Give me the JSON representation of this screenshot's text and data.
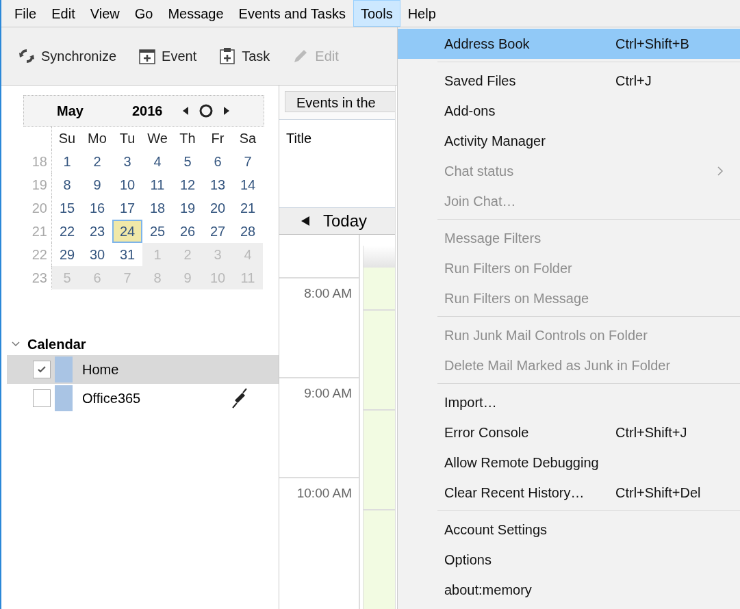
{
  "menubar": [
    {
      "label": "File",
      "selected": false
    },
    {
      "label": "Edit",
      "selected": false
    },
    {
      "label": "View",
      "selected": false
    },
    {
      "label": "Go",
      "selected": false
    },
    {
      "label": "Message",
      "selected": false
    },
    {
      "label": "Events and Tasks",
      "selected": false
    },
    {
      "label": "Tools",
      "selected": true
    },
    {
      "label": "Help",
      "selected": false
    }
  ],
  "toolbar": [
    {
      "label": "Synchronize",
      "kind": "sync",
      "disabled": false
    },
    {
      "label": "Event",
      "kind": "event",
      "disabled": false
    },
    {
      "label": "Task",
      "kind": "task",
      "disabled": false
    },
    {
      "label": "Edit",
      "kind": "edit",
      "disabled": true
    }
  ],
  "minimonth": {
    "month": "May",
    "year": "2016",
    "weekdays": [
      "Su",
      "Mo",
      "Tu",
      "We",
      "Th",
      "Fr",
      "Sa"
    ],
    "weeks": [
      {
        "number": "18",
        "days": [
          {
            "day": "1",
            "other_month": false,
            "selected": false
          },
          {
            "day": "2",
            "other_month": false,
            "selected": false
          },
          {
            "day": "3",
            "other_month": false,
            "selected": false
          },
          {
            "day": "4",
            "other_month": false,
            "selected": false
          },
          {
            "day": "5",
            "other_month": false,
            "selected": false
          },
          {
            "day": "6",
            "other_month": false,
            "selected": false
          },
          {
            "day": "7",
            "other_month": false,
            "selected": false
          }
        ]
      },
      {
        "number": "19",
        "days": [
          {
            "day": "8",
            "other_month": false,
            "selected": false
          },
          {
            "day": "9",
            "other_month": false,
            "selected": false
          },
          {
            "day": "10",
            "other_month": false,
            "selected": false
          },
          {
            "day": "11",
            "other_month": false,
            "selected": false
          },
          {
            "day": "12",
            "other_month": false,
            "selected": false
          },
          {
            "day": "13",
            "other_month": false,
            "selected": false
          },
          {
            "day": "14",
            "other_month": false,
            "selected": false
          }
        ]
      },
      {
        "number": "20",
        "days": [
          {
            "day": "15",
            "other_month": false,
            "selected": false
          },
          {
            "day": "16",
            "other_month": false,
            "selected": false
          },
          {
            "day": "17",
            "other_month": false,
            "selected": false
          },
          {
            "day": "18",
            "other_month": false,
            "selected": false
          },
          {
            "day": "19",
            "other_month": false,
            "selected": false
          },
          {
            "day": "20",
            "other_month": false,
            "selected": false
          },
          {
            "day": "21",
            "other_month": false,
            "selected": false
          }
        ]
      },
      {
        "number": "21",
        "days": [
          {
            "day": "22",
            "other_month": false,
            "selected": false
          },
          {
            "day": "23",
            "other_month": false,
            "selected": false
          },
          {
            "day": "24",
            "other_month": false,
            "selected": true
          },
          {
            "day": "25",
            "other_month": false,
            "selected": false
          },
          {
            "day": "26",
            "other_month": false,
            "selected": false
          },
          {
            "day": "27",
            "other_month": false,
            "selected": false
          },
          {
            "day": "28",
            "other_month": false,
            "selected": false
          }
        ]
      },
      {
        "number": "22",
        "days": [
          {
            "day": "29",
            "other_month": false,
            "selected": false
          },
          {
            "day": "30",
            "other_month": false,
            "selected": false
          },
          {
            "day": "31",
            "other_month": false,
            "selected": false
          },
          {
            "day": "1",
            "other_month": true,
            "selected": false
          },
          {
            "day": "2",
            "other_month": true,
            "selected": false
          },
          {
            "day": "3",
            "other_month": true,
            "selected": false
          },
          {
            "day": "4",
            "other_month": true,
            "selected": false
          }
        ]
      },
      {
        "number": "23",
        "days": [
          {
            "day": "5",
            "other_month": true,
            "selected": false
          },
          {
            "day": "6",
            "other_month": true,
            "selected": false
          },
          {
            "day": "7",
            "other_month": true,
            "selected": false
          },
          {
            "day": "8",
            "other_month": true,
            "selected": false
          },
          {
            "day": "9",
            "other_month": true,
            "selected": false
          },
          {
            "day": "10",
            "other_month": true,
            "selected": false
          },
          {
            "day": "11",
            "other_month": true,
            "selected": false
          }
        ]
      }
    ]
  },
  "calendar_list": {
    "title": "Calendar",
    "expanded": true,
    "items": [
      {
        "name": "Home",
        "checked": true,
        "selected": true,
        "color": "#a9c4e4",
        "offline": false
      },
      {
        "name": "Office365",
        "checked": false,
        "selected": false,
        "color": "#a9c4e4",
        "offline": true
      }
    ]
  },
  "events_filter": "Events in the",
  "event_list": {
    "columns": [
      "Title"
    ]
  },
  "today_button": "Today",
  "day_view": {
    "times": [
      "8:00 AM",
      "9:00 AM",
      "10:00 AM"
    ]
  },
  "tools_menu": [
    {
      "kind": "item",
      "label": "Address Book",
      "shortcut": "Ctrl+Shift+B",
      "selected": true,
      "disabled": false,
      "submenu": false
    },
    {
      "kind": "separator"
    },
    {
      "kind": "item",
      "label": "Saved Files",
      "shortcut": "Ctrl+J",
      "selected": false,
      "disabled": false,
      "submenu": false
    },
    {
      "kind": "item",
      "label": "Add-ons",
      "selected": false,
      "disabled": false,
      "submenu": false
    },
    {
      "kind": "item",
      "label": "Activity Manager",
      "selected": false,
      "disabled": false,
      "submenu": false
    },
    {
      "kind": "item",
      "label": "Chat status",
      "selected": false,
      "disabled": true,
      "submenu": true
    },
    {
      "kind": "item",
      "label": "Join Chat…",
      "selected": false,
      "disabled": true,
      "submenu": false
    },
    {
      "kind": "separator"
    },
    {
      "kind": "item",
      "label": "Message Filters",
      "selected": false,
      "disabled": true,
      "submenu": false
    },
    {
      "kind": "item",
      "label": "Run Filters on Folder",
      "selected": false,
      "disabled": true,
      "submenu": false
    },
    {
      "kind": "item",
      "label": "Run Filters on Message",
      "selected": false,
      "disabled": true,
      "submenu": false
    },
    {
      "kind": "separator"
    },
    {
      "kind": "item",
      "label": "Run Junk Mail Controls on Folder",
      "selected": false,
      "disabled": true,
      "submenu": false
    },
    {
      "kind": "item",
      "label": "Delete Mail Marked as Junk in Folder",
      "selected": false,
      "disabled": true,
      "submenu": false
    },
    {
      "kind": "separator"
    },
    {
      "kind": "item",
      "label": "Import…",
      "selected": false,
      "disabled": false,
      "submenu": false
    },
    {
      "kind": "item",
      "label": "Error Console",
      "shortcut": "Ctrl+Shift+J",
      "selected": false,
      "disabled": false,
      "submenu": false
    },
    {
      "kind": "item",
      "label": "Allow Remote Debugging",
      "selected": false,
      "disabled": false,
      "submenu": false
    },
    {
      "kind": "item",
      "label": "Clear Recent History…",
      "shortcut": "Ctrl+Shift+Del",
      "selected": false,
      "disabled": false,
      "submenu": false
    },
    {
      "kind": "separator"
    },
    {
      "kind": "item",
      "label": "Account Settings",
      "selected": false,
      "disabled": false,
      "submenu": false
    },
    {
      "kind": "item",
      "label": "Options",
      "selected": false,
      "disabled": false,
      "submenu": false
    },
    {
      "kind": "item",
      "label": "about:memory",
      "selected": false,
      "disabled": false,
      "submenu": false
    }
  ]
}
